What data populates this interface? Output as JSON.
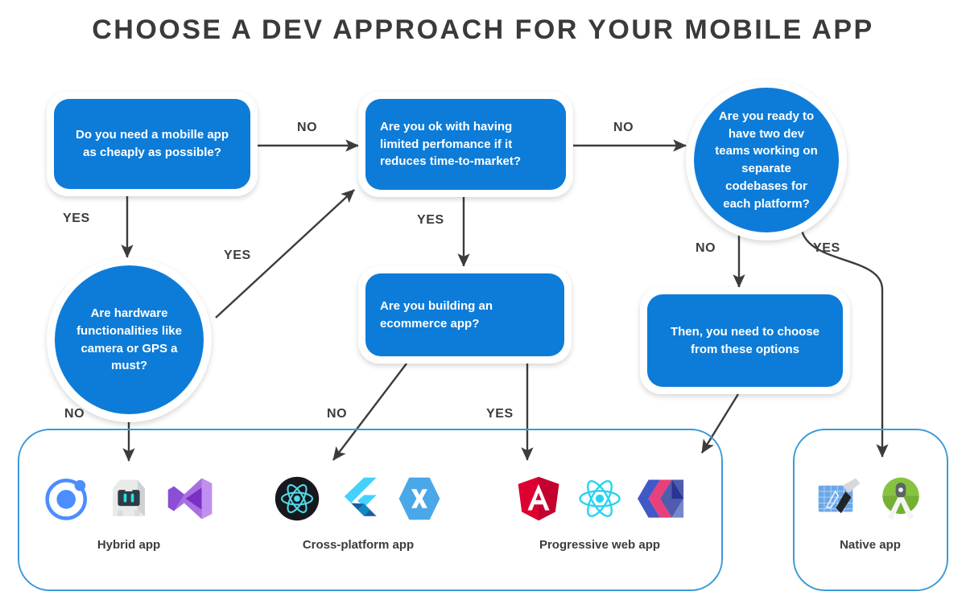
{
  "title": "CHOOSE A DEV APPROACH FOR YOUR MOBILE APP",
  "colors": {
    "node_blue": "#0d7cd8",
    "node_text": "#ffffff",
    "label_text": "#3c3c3c",
    "container_border": "#3b9ad9",
    "arrow": "#3c3c3c",
    "background": "#ffffff"
  },
  "nodes": {
    "q_cheap": "Do you need a mobille app as cheaply as possible?",
    "q_performance": "Are you ok with having limited perfomance if it reduces time-to-market?",
    "q_two_teams": "Are you ready to have two dev teams working on separate codebases for each platform?",
    "q_hardware": "Are hardware functionalities like camera or GPS a must?",
    "q_ecommerce": "Are you building an ecommerce app?",
    "then_choose": "Then, you need to choose from these options"
  },
  "edges": [
    {
      "id": "cheap-to-performance",
      "label": "NO"
    },
    {
      "id": "cheap-to-hardware",
      "label": "YES"
    },
    {
      "id": "performance-to-twoteams",
      "label": "NO"
    },
    {
      "id": "performance-to-ecommerce",
      "label": "YES"
    },
    {
      "id": "hardware-to-performance",
      "label": "YES"
    },
    {
      "id": "hardware-to-hybrid",
      "label": "NO"
    },
    {
      "id": "twoteams-to-thenchoose",
      "label": "NO"
    },
    {
      "id": "twoteams-to-native",
      "label": "YES"
    },
    {
      "id": "ecommerce-to-crossplatform",
      "label": "NO"
    },
    {
      "id": "ecommerce-to-pwa",
      "label": "YES"
    }
  ],
  "outcomes": [
    {
      "id": "hybrid",
      "label": "Hybrid app",
      "icons": [
        "ionic-icon",
        "cordova-robot-icon",
        "visual-studio-icon"
      ]
    },
    {
      "id": "cross-platform",
      "label": "Cross-platform app",
      "icons": [
        "react-native-icon",
        "flutter-icon",
        "xamarin-icon"
      ]
    },
    {
      "id": "progressive-web",
      "label": "Progressive web app",
      "icons": [
        "angular-icon",
        "react-icon",
        "polymer-icon"
      ]
    },
    {
      "id": "native",
      "label": "Native app",
      "icons": [
        "xcode-icon",
        "android-studio-icon"
      ]
    }
  ]
}
